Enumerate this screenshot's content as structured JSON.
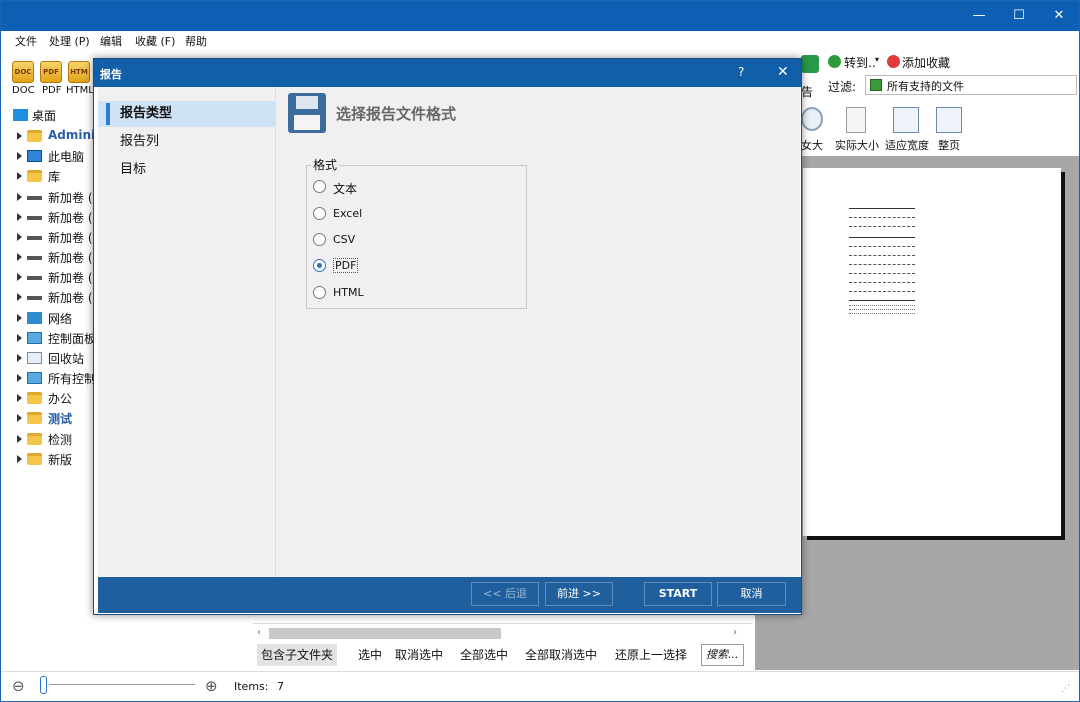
{
  "window": {
    "controls": {
      "minimize": "—",
      "maximize": "☐",
      "close": "✕"
    }
  },
  "menu": [
    {
      "label": "文件"
    },
    {
      "label": "处理 (P)"
    },
    {
      "label": "编辑"
    },
    {
      "label": "收藏 (F)"
    },
    {
      "label": "帮助"
    }
  ],
  "toolbar": {
    "formats": [
      {
        "icon": "DOC",
        "label": "DOC"
      },
      {
        "icon": "PDF",
        "label": "PDF"
      },
      {
        "icon": "HTM",
        "label": "HTML"
      }
    ],
    "goto_label": "转到..",
    "favorite_label": "添加收藏",
    "report_fragment": "告",
    "filter_label": "过滤:",
    "filter_value": "所有支持的文件",
    "zoom_in_fragment": "女大",
    "actual_size": "实际大小",
    "fit_width": "适应宽度",
    "whole_page": "整页"
  },
  "tree": [
    {
      "label": "桌面",
      "icon": "desktop",
      "bold": false,
      "level": 0
    },
    {
      "label": "Administ",
      "icon": "folder",
      "bold": true,
      "level": 1
    },
    {
      "label": "此电脑",
      "icon": "monitor",
      "bold": false,
      "level": 1
    },
    {
      "label": "库",
      "icon": "folder",
      "bold": false,
      "level": 1
    },
    {
      "label": "新加卷 (",
      "icon": "drive",
      "bold": false,
      "level": 1
    },
    {
      "label": "新加卷 (",
      "icon": "drive",
      "bold": false,
      "level": 1
    },
    {
      "label": "新加卷 (",
      "icon": "drive",
      "bold": false,
      "level": 1
    },
    {
      "label": "新加卷 (",
      "icon": "drive",
      "bold": false,
      "level": 1
    },
    {
      "label": "新加卷 (",
      "icon": "drive",
      "bold": false,
      "level": 1
    },
    {
      "label": "新加卷 (",
      "icon": "drive",
      "bold": false,
      "level": 1
    },
    {
      "label": "网络",
      "icon": "network",
      "bold": false,
      "level": 1
    },
    {
      "label": "控制面板",
      "icon": "control",
      "bold": false,
      "level": 1
    },
    {
      "label": "回收站",
      "icon": "bin",
      "bold": false,
      "level": 1
    },
    {
      "label": "所有控制",
      "icon": "control",
      "bold": false,
      "level": 1
    },
    {
      "label": "办公",
      "icon": "folder",
      "bold": false,
      "level": 1
    },
    {
      "label": "测试",
      "icon": "folder",
      "bold": true,
      "level": 1
    },
    {
      "label": "检测",
      "icon": "folder",
      "bold": false,
      "level": 1
    },
    {
      "label": "新版",
      "icon": "folder",
      "bold": false,
      "level": 1
    }
  ],
  "lower_toolbar": {
    "buttons": [
      {
        "label": "包含子文件夹"
      },
      {
        "label": "选中"
      },
      {
        "label": "取消选中"
      },
      {
        "label": "全部选中"
      },
      {
        "label": "全部取消选中"
      },
      {
        "label": "还原上一选择"
      },
      {
        "label": "搜索..."
      }
    ]
  },
  "status": {
    "items_label": "Items:",
    "items_count": "7",
    "zoom_out": "⊖",
    "zoom_in": "⊕"
  },
  "dialog": {
    "title": "报告",
    "help": "?",
    "close": "✕",
    "nav": [
      {
        "label": "报告类型",
        "active": true
      },
      {
        "label": "报告列",
        "active": false
      },
      {
        "label": "目标",
        "active": false
      }
    ],
    "heading": "选择报告文件格式",
    "group_label": "格式",
    "formats": [
      {
        "label": "文本",
        "checked": false
      },
      {
        "label": "Excel",
        "checked": false
      },
      {
        "label": "CSV",
        "checked": false
      },
      {
        "label": "PDF",
        "checked": true
      },
      {
        "label": "HTML",
        "checked": false
      }
    ],
    "buttons": {
      "back": "<< 后退",
      "next": "前进 >>",
      "start": "START",
      "cancel": "取消"
    }
  },
  "colors": {
    "titlebar": "#0d5fb3",
    "dialog_title": "#115fa8",
    "dialog_footer": "#1f5f9d",
    "nav_active": "#cfe3f7",
    "accent": "#2a7fd4"
  }
}
